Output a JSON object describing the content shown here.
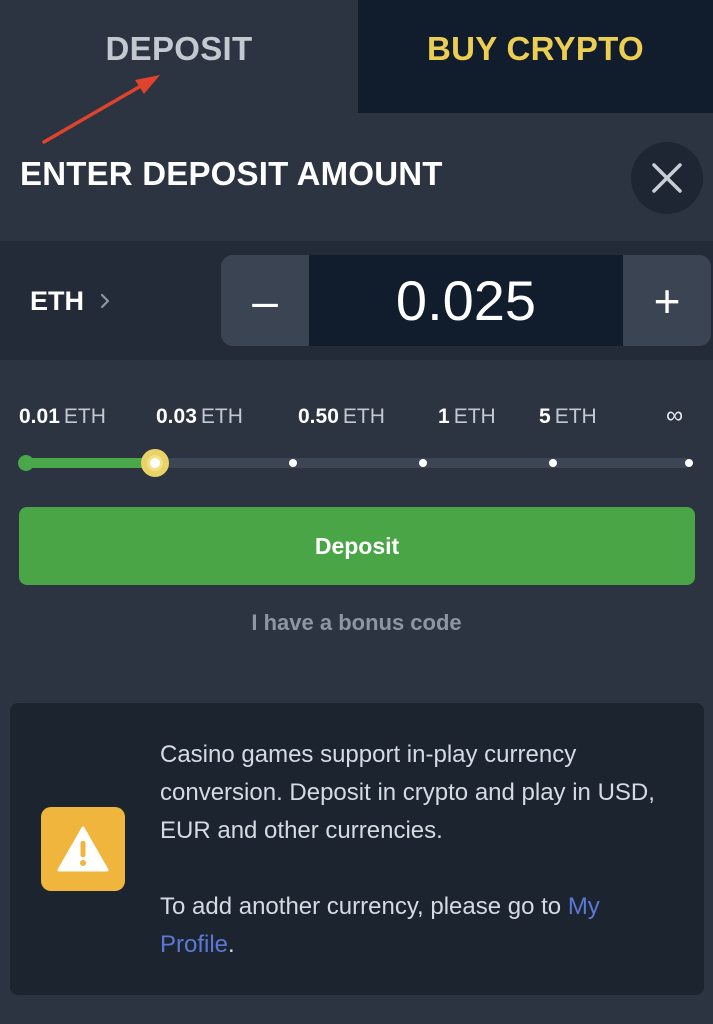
{
  "tabs": {
    "deposit": "DEPOSIT",
    "buy_crypto": "BUY CRYPTO"
  },
  "header": {
    "title": "ENTER DEPOSIT AMOUNT"
  },
  "amount": {
    "currency": "ETH",
    "value": "0.025",
    "minus": "–",
    "plus": "+"
  },
  "presets": [
    {
      "amount": "0.01",
      "unit": "ETH"
    },
    {
      "amount": "0.03",
      "unit": "ETH"
    },
    {
      "amount": "0.50",
      "unit": "ETH"
    },
    {
      "amount": "1",
      "unit": "ETH"
    },
    {
      "amount": "5",
      "unit": "ETH"
    },
    {
      "amount": "∞",
      "unit": ""
    }
  ],
  "slider": {
    "selected_index": 1,
    "fill_fraction": 0.2
  },
  "deposit_button": "Deposit",
  "bonus_link": "I have a bonus code",
  "notice": {
    "line1": "Casino games support in-play currency conversion. Deposit in crypto and play in USD, EUR and other currencies.",
    "line2_prefix": "To add another currency, please go to ",
    "line2_link": "My Profile",
    "line2_suffix": "."
  },
  "colors": {
    "accent_green": "#49a545",
    "accent_yellow": "#eccf52",
    "warning": "#f0b53c",
    "link": "#5b78d4",
    "annotation_arrow": "#e0432c"
  },
  "icons": [
    "close-icon",
    "chevron-right-icon",
    "warning-icon",
    "arrow-annotation"
  ]
}
